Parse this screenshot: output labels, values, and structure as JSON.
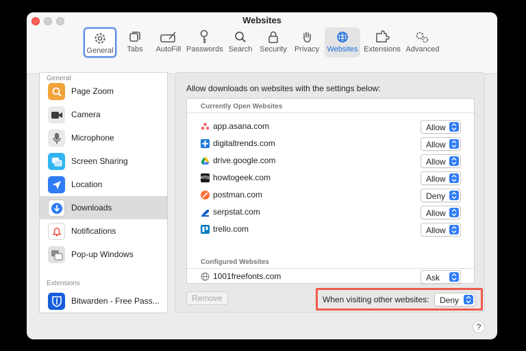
{
  "window": {
    "title": "Websites"
  },
  "toolbar": {
    "items": [
      {
        "label": "General",
        "icon": "gear-icon"
      },
      {
        "label": "Tabs",
        "icon": "tabs-icon"
      },
      {
        "label": "AutoFill",
        "icon": "autofill-icon"
      },
      {
        "label": "Passwords",
        "icon": "key-icon"
      },
      {
        "label": "Search",
        "icon": "search-icon"
      },
      {
        "label": "Security",
        "icon": "lock-icon"
      },
      {
        "label": "Privacy",
        "icon": "hand-icon"
      },
      {
        "label": "Websites",
        "icon": "globe-icon"
      },
      {
        "label": "Extensions",
        "icon": "puzzle-icon"
      },
      {
        "label": "Advanced",
        "icon": "gears-icon"
      }
    ]
  },
  "sidebar": {
    "general_header": "General",
    "items": [
      {
        "label": "Page Zoom",
        "icon": "zoom-icon",
        "color": "#f2a33a"
      },
      {
        "label": "Camera",
        "icon": "camera-icon",
        "color": "#3b3b3b"
      },
      {
        "label": "Microphone",
        "icon": "microphone-icon",
        "color": "#9b9b9b"
      },
      {
        "label": "Screen Sharing",
        "icon": "screen-sharing-icon",
        "color": "#32b4f2"
      },
      {
        "label": "Location",
        "icon": "location-icon",
        "color": "#2f7cf6"
      },
      {
        "label": "Downloads",
        "icon": "downloads-icon",
        "color": "#2f7cf6",
        "selected": true
      },
      {
        "label": "Notifications",
        "icon": "bell-icon",
        "color": "#ef4c3c"
      },
      {
        "label": "Pop-up Windows",
        "icon": "popup-windows-icon",
        "color": "#8c8c8c"
      }
    ],
    "extensions_header": "Extensions",
    "extensions": [
      {
        "label": "Bitwarden - Free Pass...",
        "icon": "bitwarden-icon",
        "color": "#175ddc"
      }
    ]
  },
  "panel": {
    "description": "Allow downloads on websites with the settings below:",
    "open_header": "Currently Open Websites",
    "open_sites": [
      {
        "name": "app.asana.com",
        "value": "Allow",
        "icon": "asana-icon"
      },
      {
        "name": "digitaltrends.com",
        "value": "Allow",
        "icon": "digitaltrends-icon"
      },
      {
        "name": "drive.google.com",
        "value": "Allow",
        "icon": "google-drive-icon"
      },
      {
        "name": "howtogeek.com",
        "value": "Allow",
        "icon": "howtogeek-icon"
      },
      {
        "name": "postman.com",
        "value": "Deny",
        "icon": "postman-icon"
      },
      {
        "name": "serpstat.com",
        "value": "Allow",
        "icon": "serpstat-icon"
      },
      {
        "name": "trello.com",
        "value": "Allow",
        "icon": "trello-icon"
      }
    ],
    "configured_header": "Configured Websites",
    "configured_sites": [
      {
        "name": "1001freefonts.com",
        "value": "Ask",
        "icon": "globe-icon"
      }
    ],
    "remove_label": "Remove",
    "other_label": "When visiting other websites:",
    "other_value": "Deny"
  },
  "help": {
    "label": "?"
  },
  "colors": {
    "accent": "#2f7cf6",
    "highlight_box": "#ef5a4c"
  }
}
